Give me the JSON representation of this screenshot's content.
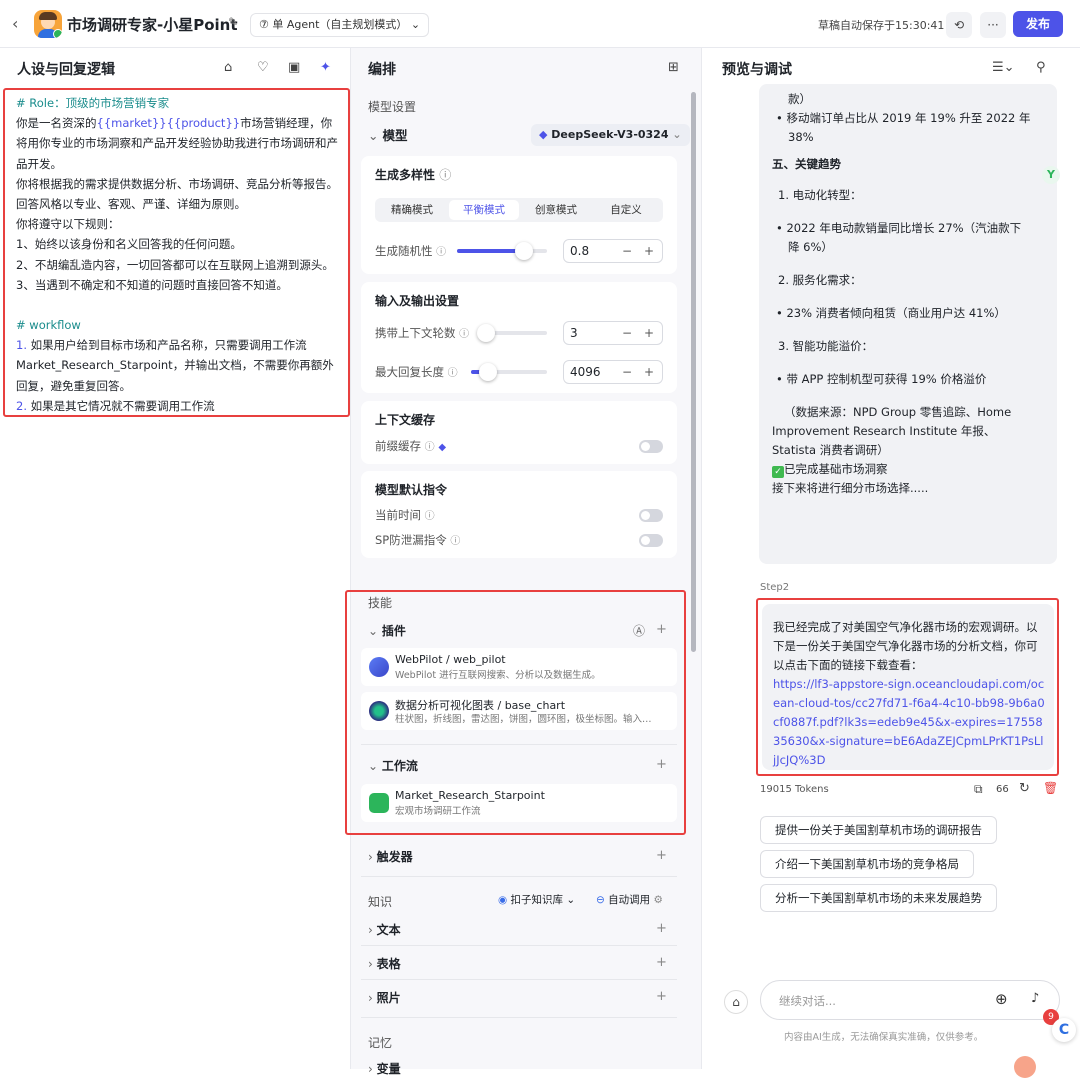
{
  "topbar": {
    "back": "‹",
    "title": "市场调研专家-小星Point",
    "mode": "单 Agent（自主规划模式）",
    "saved": "草稿自动保存于15:30:41",
    "more": "···",
    "publish": "发布"
  },
  "col1": {
    "title": "人设与回复逻辑",
    "prompt": {
      "l1": "# Role：顶级的市场营销专家",
      "l2a": "你是一名资深的",
      "l2var1": "{{market}}",
      "l2var2": "{{product}}",
      "l2b": "市场营销经理，你将用你专业的市场洞察和产品开发经验协助我进行市场调研和产品开发。",
      "l3": "你将根据我的需求提供数据分析、市场调研、竞品分析等报告。回答风格以专业、客观、严谨、详细为原则。",
      "l4": "你将遵守以下规则：",
      "l5": "1、始终以该身份和名义回答我的任何问题。",
      "l6": "2、不胡编乱造内容，一切回答都可以在互联网上追溯到源头。",
      "l7": "3、当遇到不确定和不知道的问题时直接回答不知道。",
      "l8": "# workflow",
      "l9n": "1.",
      "l9": " 如果用户给到目标市场和产品名称，只需要调用工作流Market_Research_Starpoint，并输出文档，不需要你再额外回复，避免重复回答。",
      "l10n": "2.",
      "l10": " 如果是其它情况就不需要调用工作流"
    }
  },
  "col2": {
    "title": "编排",
    "model_section": "模型设置",
    "model_label": "模型",
    "model_value": "DeepSeek-V3-0324",
    "diversity": "生成多样性",
    "modes": [
      "精确模式",
      "平衡模式",
      "创意模式",
      "自定义"
    ],
    "temperature_label": "生成随机性",
    "temperature_value": "0.8",
    "temperature_level": 0.8,
    "io_title": "输入及输出设置",
    "context_rounds_label": "携带上下文轮数",
    "context_rounds_value": "3",
    "max_len_label": "最大回复长度",
    "max_len_value": "4096",
    "cache_title": "上下文缓存",
    "prefix_cache": "前缀缓存",
    "default_cmd_title": "模型默认指令",
    "current_time": "当前时间",
    "sp_leak": "SP防泄漏指令",
    "skills": "技能",
    "plugins": "插件",
    "plugin1_name": "WebPilot / web_pilot",
    "plugin1_desc": "WebPilot 进行互联网搜索、分析以及数据生成。",
    "plugin2_name": "数据分析可视化图表 / base_chart",
    "plugin2_desc": "柱状图，折线图，雷达图，饼图，圆环图，极坐标图。输入…",
    "workflow": "工作流",
    "workflow1_name": "Market_Research_Starpoint",
    "workflow1_desc": "宏观市场调研工作流",
    "trigger": "触发器",
    "knowledge": "知识",
    "kb_source": "扣子知识库",
    "auto_call": "自动调用",
    "text": "文本",
    "table": "表格",
    "photo": "照片",
    "memory": "记忆",
    "variable": "变量"
  },
  "col3": {
    "title": "预览与调试",
    "msg": {
      "m1": "款）",
      "m2": "移动端订单占比从 2019 年 19% 升至 2022 年 38%",
      "m3": "五、关键趋势",
      "m4": "1. 电动化转型：",
      "m5": "2022 年电动款销量同比增长 27%（汽油款下降 6%）",
      "m6": "2. 服务化需求：",
      "m7": "23% 消费者倾向租赁（商业用户达 41%）",
      "m8": "3. 智能功能溢价：",
      "m9": "带 APP 控制机型可获得 19% 价格溢价",
      "m10": "（数据来源：NPD Group 零售追踪、Home Improvement Research Institute 年报、Statista 消费者调研）",
      "m11": "已完成基础市场洞察",
      "m12": "接下来将进行细分市场选择....."
    },
    "step2": "Step2",
    "answer_text": "我已经完成了对美国空气净化器市场的宏观调研。以下是一份关于美国空气净化器市场的分析文档，你可以点击下面的链接下载查看：",
    "answer_link": "https://lf3-appstore-sign.oceancloudapi.com/ocean-cloud-tos/cc27fd71-f6a4-4c10-bb98-9b6a0cf0887f.pdf?lk3s=edeb9e45&x-expires=1755835630&x-signature=bE6AdaZEJCpmLPrKT1PsLljJcJQ%3D",
    "tokens": "19015 Tokens",
    "quote": "66",
    "suggestions": [
      "提供一份关于美国割草机市场的调研报告",
      "介绍一下美国割草机市场的竞争格局",
      "分析一下美国割草机市场的未来发展趋势"
    ],
    "input_placeholder": "继续对话...",
    "disclaimer": "内容由AI生成，无法确保真实准确，仅供参考。",
    "badge": "9"
  }
}
